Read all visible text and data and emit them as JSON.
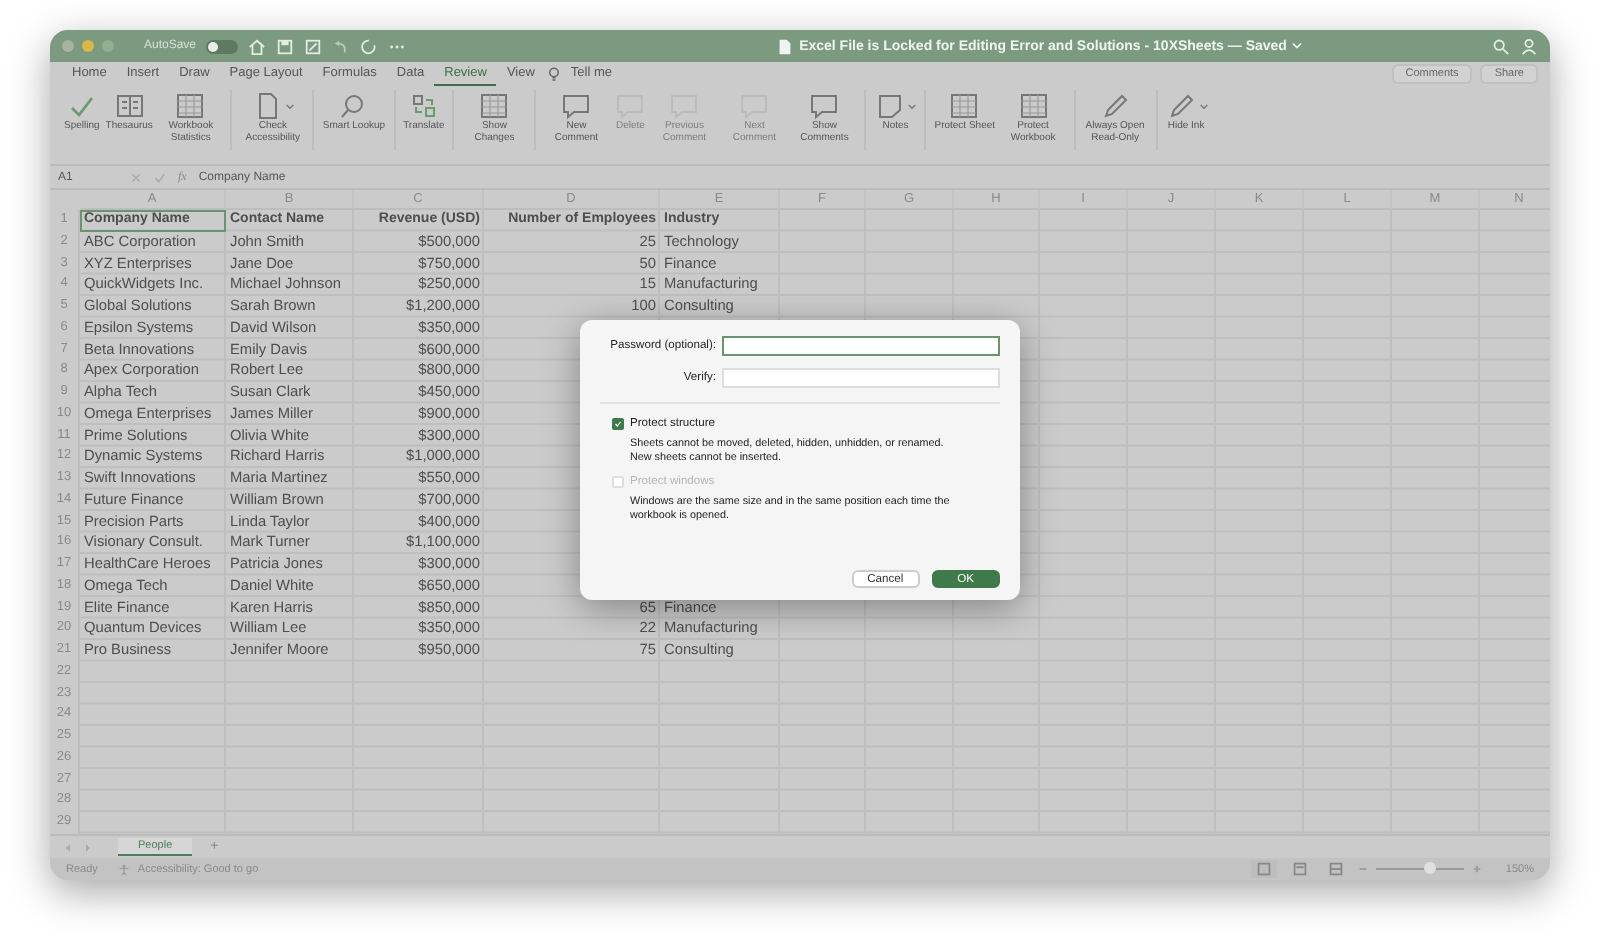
{
  "title_bar": {
    "autosave_label": "AutoSave",
    "autosave_on": false,
    "title": "Excel File is Locked for Editing Error and Solutions - 10XSheets — Saved"
  },
  "menu_tabs": [
    {
      "label": "Home",
      "selected": false
    },
    {
      "label": "Insert",
      "selected": false
    },
    {
      "label": "Draw",
      "selected": false
    },
    {
      "label": "Page Layout",
      "selected": false
    },
    {
      "label": "Formulas",
      "selected": false
    },
    {
      "label": "Data",
      "selected": false
    },
    {
      "label": "Review",
      "selected": true
    },
    {
      "label": "View",
      "selected": false
    }
  ],
  "tell_me": "Tell me",
  "header_buttons": [
    "Comments",
    "Share"
  ],
  "ribbon": {
    "groups": [
      {
        "items": [
          {
            "label": "Spelling",
            "disabled": false,
            "dropdown": false
          },
          {
            "label": "Thesaurus",
            "disabled": false,
            "dropdown": false
          },
          {
            "label": "Workbook Statistics",
            "disabled": false,
            "dropdown": false
          }
        ]
      },
      {
        "items": [
          {
            "label": "Check Accessibility",
            "disabled": false,
            "dropdown": true
          }
        ]
      },
      {
        "items": [
          {
            "label": "Smart Lookup",
            "disabled": false,
            "dropdown": false
          }
        ]
      },
      {
        "items": [
          {
            "label": "Translate",
            "disabled": false,
            "dropdown": false
          }
        ]
      },
      {
        "items": [
          {
            "label": "Show Changes",
            "disabled": false,
            "dropdown": false
          }
        ]
      },
      {
        "items": [
          {
            "label": "New Comment",
            "disabled": false,
            "dropdown": false
          },
          {
            "label": "Delete",
            "disabled": true,
            "dropdown": false
          },
          {
            "label": "Previous Comment",
            "disabled": true,
            "dropdown": false
          },
          {
            "label": "Next Comment",
            "disabled": true,
            "dropdown": false
          },
          {
            "label": "Show Comments",
            "disabled": false,
            "dropdown": false
          }
        ]
      },
      {
        "items": [
          {
            "label": "Notes",
            "disabled": false,
            "dropdown": true
          }
        ]
      },
      {
        "items": [
          {
            "label": "Protect Sheet",
            "disabled": false,
            "dropdown": false
          },
          {
            "label": "Protect Workbook",
            "disabled": false,
            "dropdown": false
          }
        ]
      },
      {
        "items": [
          {
            "label": "Always Open Read-Only",
            "disabled": false,
            "dropdown": false
          }
        ]
      },
      {
        "items": [
          {
            "label": "Hide Ink",
            "disabled": false,
            "dropdown": true
          }
        ]
      }
    ]
  },
  "formula_bar": {
    "name_box": "A1",
    "fx_label": "fx",
    "formula": "Company Name"
  },
  "grid": {
    "columns": [
      "A",
      "B",
      "C",
      "D",
      "E",
      "F",
      "G",
      "H",
      "I",
      "J",
      "K",
      "L",
      "M",
      "N"
    ],
    "rows": [
      {
        "number": "1",
        "selected": true,
        "cells": [
          "Company Name",
          "Contact Name",
          "Revenue (USD)",
          "Number of Employees",
          "Industry"
        ]
      },
      {
        "number": "2",
        "selected": false,
        "cells": [
          "ABC Corporation",
          "John Smith",
          "$500,000",
          "25",
          "Technology"
        ]
      },
      {
        "number": "3",
        "selected": false,
        "cells": [
          "XYZ Enterprises",
          "Jane Doe",
          "$750,000",
          "50",
          "Finance"
        ]
      },
      {
        "number": "4",
        "selected": false,
        "cells": [
          "QuickWidgets Inc.",
          "Michael Johnson",
          "$250,000",
          "15",
          "Manufacturing"
        ]
      },
      {
        "number": "5",
        "selected": false,
        "cells": [
          "Global Solutions",
          "Sarah Brown",
          "$1,200,000",
          "100",
          "Consulting"
        ]
      },
      {
        "number": "6",
        "selected": false,
        "cells": [
          "Epsilon Systems",
          "David Wilson",
          "$350,000"
        ]
      },
      {
        "number": "7",
        "selected": false,
        "cells": [
          "Beta Innovations",
          "Emily Davis",
          "$600,000"
        ]
      },
      {
        "number": "8",
        "selected": false,
        "cells": [
          "Apex Corporation",
          "Robert Lee",
          "$800,000"
        ]
      },
      {
        "number": "9",
        "selected": false,
        "cells": [
          "Alpha Tech",
          "Susan Clark",
          "$450,000"
        ]
      },
      {
        "number": "10",
        "selected": false,
        "cells": [
          "Omega Enterprises",
          "James Miller",
          "$900,000"
        ]
      },
      {
        "number": "11",
        "selected": false,
        "cells": [
          "Prime Solutions",
          "Olivia White",
          "$300,000"
        ]
      },
      {
        "number": "12",
        "selected": false,
        "cells": [
          "Dynamic Systems",
          "Richard Harris",
          "$1,000,000"
        ]
      },
      {
        "number": "13",
        "selected": false,
        "cells": [
          "Swift Innovations",
          "Maria Martinez",
          "$550,000"
        ]
      },
      {
        "number": "14",
        "selected": false,
        "cells": [
          "Future Finance",
          "William Brown",
          "$700,000"
        ]
      },
      {
        "number": "15",
        "selected": false,
        "cells": [
          "Precision Parts",
          "Linda Taylor",
          "$400,000"
        ]
      },
      {
        "number": "16",
        "selected": false,
        "cells": [
          "Visionary Consult.",
          "Mark Turner",
          "$1,100,000"
        ]
      },
      {
        "number": "17",
        "selected": false,
        "cells": [
          "HealthCare Heroes",
          "Patricia Jones",
          "$300,000"
        ]
      },
      {
        "number": "18",
        "selected": false,
        "cells": [
          "Omega Tech",
          "Daniel White",
          "$650,000"
        ]
      },
      {
        "number": "19",
        "selected": false,
        "cells": [
          "Elite Finance",
          "Karen Harris",
          "$850,000",
          "65",
          "Finance"
        ]
      },
      {
        "number": "20",
        "selected": false,
        "cells": [
          "Quantum Devices",
          "William Lee",
          "$350,000",
          "22",
          "Manufacturing"
        ]
      },
      {
        "number": "21",
        "selected": false,
        "cells": [
          "Pro Business",
          "Jennifer Moore",
          "$950,000",
          "75",
          "Consulting"
        ]
      },
      {
        "number": "22",
        "selected": false
      },
      {
        "number": "23",
        "selected": false
      },
      {
        "number": "24",
        "selected": false
      },
      {
        "number": "25",
        "selected": false
      },
      {
        "number": "26",
        "selected": false
      },
      {
        "number": "27",
        "selected": false
      },
      {
        "number": "28",
        "selected": false
      },
      {
        "number": "29",
        "selected": false
      }
    ]
  },
  "sheet_tabs": [
    {
      "label": "People",
      "selected": true
    }
  ],
  "add_sheet": "+",
  "status_bar": {
    "status": "Ready",
    "accessibility": "Accessibility: Good to go",
    "zoom": {
      "level": 0.62,
      "label": "150%"
    }
  },
  "dialog": {
    "password_label": "Password (optional):",
    "verify_label": "Verify:",
    "options": [
      {
        "label": "Protect structure",
        "checked": true,
        "disabled": false,
        "description": "Sheets cannot be moved, deleted, hidden, unhidden, or renamed. New sheets cannot be inserted."
      },
      {
        "label": "Protect windows",
        "checked": false,
        "disabled": true,
        "description": "Windows are the same size and in the same position each time the workbook is opened."
      }
    ],
    "buttons": [
      {
        "label": "Cancel",
        "kind": "secondary"
      },
      {
        "label": "OK",
        "kind": "primary"
      }
    ]
  }
}
